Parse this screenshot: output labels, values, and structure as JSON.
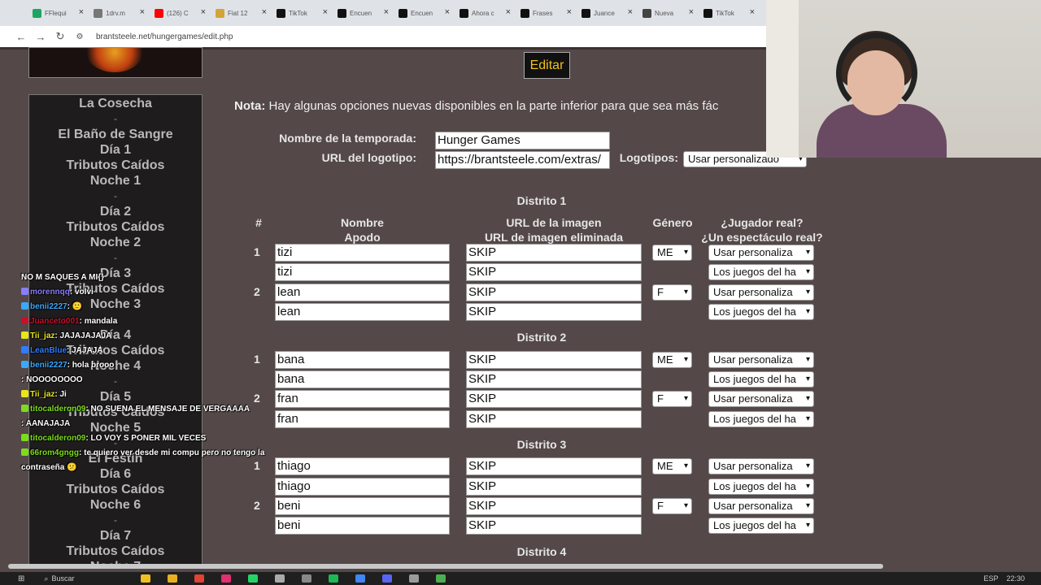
{
  "browser": {
    "tabs": [
      {
        "label": "FFlequi",
        "color": "#1fa463"
      },
      {
        "label": "1drv.m",
        "color": "#777777"
      },
      {
        "label": "(126) C",
        "color": "#ff0000"
      },
      {
        "label": "Fiat 12",
        "color": "#d4a437"
      },
      {
        "label": "TikTok",
        "color": "#111111"
      },
      {
        "label": "Encuen",
        "color": "#111111"
      },
      {
        "label": "Encuen",
        "color": "#111111"
      },
      {
        "label": "Ahora c",
        "color": "#111111"
      },
      {
        "label": "Frases",
        "color": "#111111"
      },
      {
        "label": "Juance",
        "color": "#111111"
      },
      {
        "label": "Nueva",
        "color": "#444444"
      },
      {
        "label": "TikTok",
        "color": "#111111"
      }
    ],
    "url": "brantsteele.net/hungergames/edit.php"
  },
  "sidebar": {
    "items": [
      "La Cosecha",
      "-",
      "El Baño de Sangre",
      "Día 1",
      "Tributos Caídos",
      "Noche 1",
      "-",
      "Día 2",
      "Tributos Caídos",
      "Noche 2",
      "-",
      "Día 3",
      "Tributos Caídos",
      "Noche 3",
      "-",
      "Día 4",
      "Tributos Caídos",
      "Noche 4",
      "-",
      "Día 5",
      "Tributos Caídos",
      "Noche 5",
      "-",
      "El Festín",
      "Día 6",
      "Tributos Caídos",
      "Noche 6",
      "-",
      "Día 7",
      "Tributos Caídos",
      "Noche 7"
    ]
  },
  "main": {
    "edit_label": "Editar",
    "nota_label": "Nota:",
    "nota_text": " Hay algunas opciones nuevas disponibles en la parte inferior para que sea más fác",
    "season_label": "Nombre de la temporada:",
    "season_value": "Hunger Games",
    "logo_url_label": "URL del logotipo:",
    "logo_url_value": "https://brantsteele.com/extras/",
    "logos_label": "Logotipos:",
    "logos_value": "Usar personalizado",
    "headers": {
      "num": "#",
      "name": "Nombre",
      "nick": "Apodo",
      "img": "URL de la imagen",
      "img_dead": "URL de imagen eliminada",
      "gender": "Género",
      "real": "¿Jugador real?",
      "show": "¿Un espectáculo real?"
    },
    "districts": [
      {
        "title": "Distrito 1",
        "players": [
          {
            "num": "1",
            "name": "tizi",
            "nick": "tizi",
            "img": "SKIP",
            "img2": "SKIP",
            "gender": "ME",
            "real": "Usar personaliza",
            "show": "Los juegos del ha"
          },
          {
            "num": "2",
            "name": "lean",
            "nick": "lean",
            "img": "SKIP",
            "img2": "SKIP",
            "gender": "F",
            "real": "Usar personaliza",
            "show": "Los juegos del ha"
          }
        ]
      },
      {
        "title": "Distrito 2",
        "players": [
          {
            "num": "1",
            "name": "bana",
            "nick": "bana",
            "img": "SKIP",
            "img2": "SKIP",
            "gender": "ME",
            "real": "Usar personaliza",
            "show": "Los juegos del ha"
          },
          {
            "num": "2",
            "name": "fran",
            "nick": "fran",
            "img": "SKIP",
            "img2": "SKIP",
            "gender": "F",
            "real": "Usar personaliza",
            "show": "Los juegos del ha"
          }
        ]
      },
      {
        "title": "Distrito 3",
        "players": [
          {
            "num": "1",
            "name": "thiago",
            "nick": "thiago",
            "img": "SKIP",
            "img2": "SKIP",
            "gender": "ME",
            "real": "Usar personaliza",
            "show": "Los juegos del ha"
          },
          {
            "num": "2",
            "name": "beni",
            "nick": "beni",
            "img": "SKIP",
            "img2": "SKIP",
            "gender": "F",
            "real": "Usar personaliza",
            "show": "Los juegos del ha"
          }
        ]
      }
    ],
    "district4_title": "Distrito 4"
  },
  "chat": [
    {
      "user": "",
      "text": "NO M SAQUES A MI{}",
      "color": "#e0245e"
    },
    {
      "user": "morennqq",
      "text": ": volvi",
      "color": "#8a7dff"
    },
    {
      "user": "benii2227",
      "text": ": 🙂",
      "color": "#3aa8ff"
    },
    {
      "user": "Juanceto001",
      "text": ": mandala",
      "color": "#c8102e"
    },
    {
      "user": "Tii_jaz",
      "text": ": JAJAJAJAJA",
      "color": "#e6e61a"
    },
    {
      "user": "LeanBlue",
      "text": ": JAJAJA",
      "color": "#2f7dff"
    },
    {
      "user": "benii2227",
      "text": ": hola brooo",
      "color": "#3aa8ff"
    },
    {
      "user": "",
      "text": ": NOOOOOOOO",
      "color": "#e0245e"
    },
    {
      "user": "Tii_jaz",
      "text": ": Ji",
      "color": "#e6e61a"
    },
    {
      "user": "titocalderon09",
      "text": ": NO SUENA EL MENSAJE DE VERGAAAA",
      "color": "#7cdc1a"
    },
    {
      "user": "",
      "text": ": AANAJAJA",
      "color": "#e0245e"
    },
    {
      "user": "titocalderon09",
      "text": ": LO VOY S PONER MIL VECES",
      "color": "#7cdc1a"
    },
    {
      "user": "66rom4gngg",
      "text": ": te quiero ver desde mi compu pero no tengo la",
      "color": "#7cdc1a"
    },
    {
      "user": "",
      "text": "contraseña 😕",
      "color": "#ffffff"
    }
  ],
  "taskbar": {
    "search_label": "Buscar",
    "lang": "ESP",
    "time": "22:30"
  }
}
